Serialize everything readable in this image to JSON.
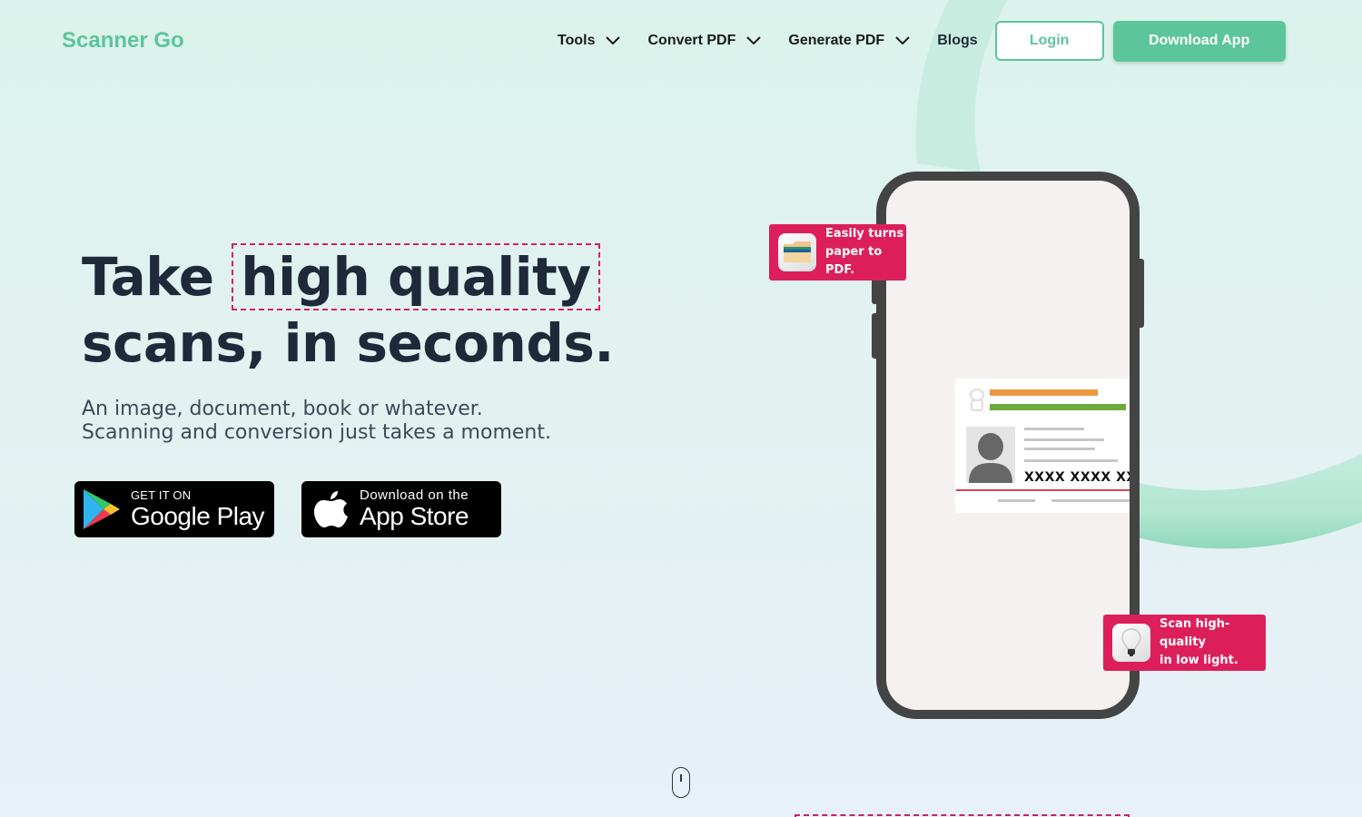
{
  "header": {
    "logo": "Scanner Go",
    "nav": [
      {
        "label": "Tools",
        "has_dropdown": true,
        "icon": "chevron-down-icon"
      },
      {
        "label": "Convert PDF",
        "has_dropdown": true,
        "icon": "chevron-down-icon"
      },
      {
        "label": "Generate PDF",
        "has_dropdown": true,
        "icon": "chevron-down-icon"
      },
      {
        "label": "Blogs",
        "has_dropdown": false
      }
    ],
    "login_label": "Login",
    "download_label": "Download App"
  },
  "hero": {
    "title_prefix": "Take",
    "title_highlight": "high quality",
    "title_line2": "scans, in seconds.",
    "subtitle_line1": "An image, document, book or whatever.",
    "subtitle_line2": "Scanning and conversion just takes a moment.",
    "badges": {
      "google": {
        "small": "GET IT ON",
        "big": "Google Play",
        "icon": "google-play-icon"
      },
      "apple": {
        "small": "Download on the",
        "big": "App Store",
        "icon": "apple-icon"
      }
    }
  },
  "phone": {
    "id_card": {
      "number": "XXXX XXXX XXXX"
    }
  },
  "callouts": [
    {
      "text": "Easily turns\npaper to PDF.",
      "icon": "folder-icon"
    },
    {
      "text": "Scan high-quality\nin low light.",
      "icon": "lightbulb-icon"
    }
  ],
  "colors": {
    "brand": "#5cc59b",
    "accent": "#dc1f5b",
    "heading": "#1e2939"
  }
}
